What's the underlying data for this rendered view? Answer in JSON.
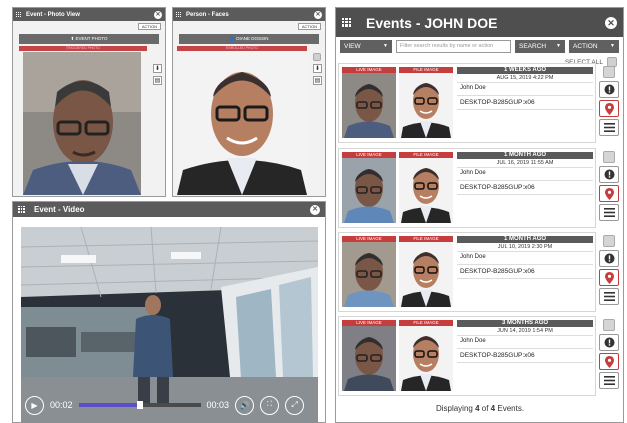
{
  "photo_view": {
    "title": "Event - Photo View",
    "action_label": "ACTION",
    "button_label": "EVENT PHOTO",
    "strip_label": "TRIGGERED PHOTO"
  },
  "faces": {
    "title": "Person - Faces",
    "action_label": "ACTION",
    "button_label": "DIANE DOSSIN",
    "strip_label": "ENROLLED PHOTO"
  },
  "video": {
    "title": "Event - Video",
    "current_time": "00:02",
    "end_time": "00:03",
    "progress": 0.5
  },
  "events": {
    "title": "Events",
    "person": "- JOHN DOE",
    "view_label": "VIEW",
    "search_placeholder": "Filter search results by name or action",
    "search_label": "SEARCH",
    "action_label": "ACTION",
    "select_all": "SELECT ALL",
    "live_label": "LIVE IMAGE",
    "file_label": "FILE IMAGE",
    "items": [
      {
        "ago": "1 WEEKS AGO",
        "date": "AUG 15, 2019 4:22 PM",
        "name": "John Doe",
        "device": "DESKTOP-B285GUP:x06"
      },
      {
        "ago": "1 MONTH AGO",
        "date": "JUL 16, 2019 11:55 AM",
        "name": "John Doe",
        "device": "DESKTOP-B285GUP:x06"
      },
      {
        "ago": "1 MONTH AGO",
        "date": "JUL 10, 2019 2:30 PM",
        "name": "John Doe",
        "device": "DESKTOP-B285GUP:x06"
      },
      {
        "ago": "3 MONTHS AGO",
        "date": "JUN 14, 2019 1:54 PM",
        "name": "John Doe",
        "device": "DESKTOP-B285GUP:x06"
      }
    ],
    "footer_prefix": "Displaying",
    "footer_shown": "4",
    "footer_of": "of",
    "footer_total": "4",
    "footer_suffix": "Events."
  },
  "colors": {
    "header": "#5b5b5b",
    "accent_red": "#c63d3d",
    "progress": "#5a4fc8"
  }
}
